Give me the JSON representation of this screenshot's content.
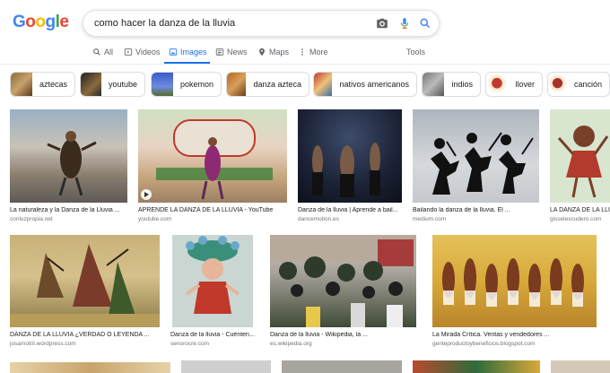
{
  "logo": {
    "letters": [
      "G",
      "o",
      "o",
      "g",
      "l",
      "e"
    ],
    "colors": [
      "#4285F4",
      "#EA4335",
      "#FBBC05",
      "#4285F4",
      "#34A853",
      "#EA4335"
    ]
  },
  "search": {
    "query": "como hacer la danza de la lluvia"
  },
  "tabs": {
    "all": "All",
    "videos": "Videos",
    "images": "Images",
    "news": "News",
    "maps": "Maps",
    "more": "More",
    "tools": "Tools"
  },
  "chips": [
    {
      "label": "aztecas"
    },
    {
      "label": "youtube"
    },
    {
      "label": "pokemon"
    },
    {
      "label": "danza azteca"
    },
    {
      "label": "nativos americanos"
    },
    {
      "label": "indios"
    },
    {
      "label": "llover"
    },
    {
      "label": "canción"
    }
  ],
  "row1": [
    {
      "caption": "La naturaleza y la Danza de la Lluvia ...",
      "source": "conluzpropia.net"
    },
    {
      "caption": "APRENDE LA DANZA DE LA LLUVIA - YouTube",
      "source": "youtube.com"
    },
    {
      "caption": "Danza de la lluvia | Aprende a bail...",
      "source": "dancemotion.es"
    },
    {
      "caption": "Bailando la danza de la lluvia. El ...",
      "source": "medium.com"
    },
    {
      "caption": "LA DANZA DE LA LLUV",
      "source": "gisselescudero.com"
    }
  ],
  "row2": [
    {
      "caption": "DANZA DE LA LLUVIA ¿VERDAD O LEYENDA ...",
      "source": "josamotril.wordpress.com"
    },
    {
      "caption": "Danza de la lluvia - Cuénten...",
      "source": "senorocre.com"
    },
    {
      "caption": "Danza de la lluvia - Wikipedia, la ...",
      "source": "es.wikipedia.org"
    },
    {
      "caption": "La Mirada Crítica. Ventas y vendedores ...",
      "source": "genteproductoybeneficios.blogspot.com"
    }
  ]
}
